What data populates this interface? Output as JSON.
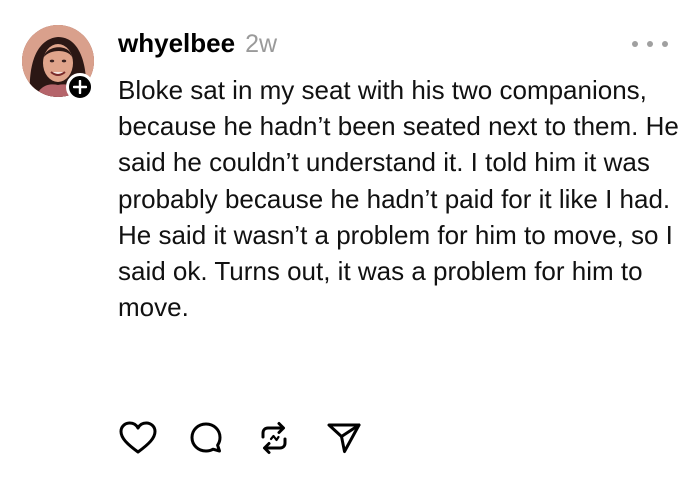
{
  "post": {
    "username": "whyelbee",
    "timestamp": "2w",
    "text": "Bloke sat in my seat with his two companions, because he hadn’t been seated next to them. He said he couldn’t understand it. I told him it was probably because he hadn’t paid for it like I had. He said it wasn’t a problem for him to move, so I said ok. Turns out, it was a problem for him to move."
  },
  "icons": {
    "follow": "plus-icon",
    "more": "more-horizontal-icon",
    "like": "heart-icon",
    "reply": "comment-bubble-icon",
    "repost": "repost-arrows-icon",
    "share": "send-paper-plane-icon"
  },
  "colors": {
    "text": "#000000",
    "muted": "#9a9a9a",
    "background": "#ffffff"
  }
}
